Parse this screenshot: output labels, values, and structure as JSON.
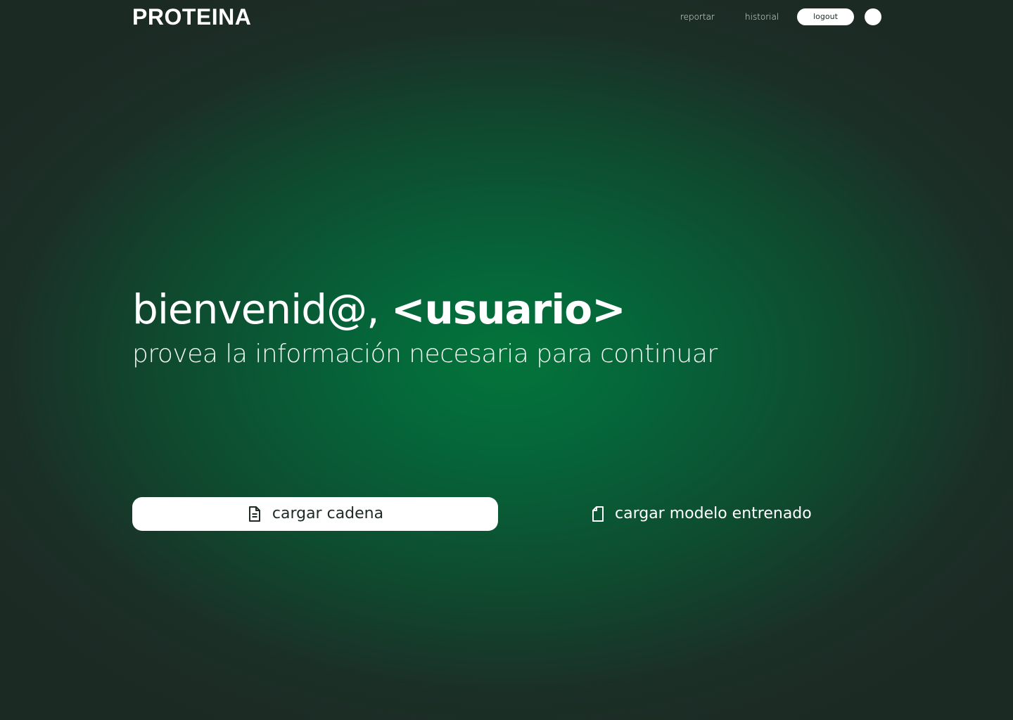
{
  "header": {
    "logo": "PROTEINA",
    "nav": {
      "reportar": "reportar",
      "historial": "historial"
    },
    "logout_label": "logout",
    "avatar_icon": "user-avatar"
  },
  "main": {
    "greeting_prefix": "bienvenid@, ",
    "greeting_name": "<usuario>",
    "subtitle": "provea la información necesaria para continuar"
  },
  "actions": {
    "primary": {
      "label": "cargar cadena",
      "icon": "document-icon"
    },
    "secondary": {
      "label": "cargar modelo entrenado",
      "icon": "file-icon"
    }
  },
  "colors": {
    "background_center": "#03743a",
    "background_edge": "#1c2a24",
    "button_bg": "#ffffff",
    "button_text": "#1d2b24"
  }
}
